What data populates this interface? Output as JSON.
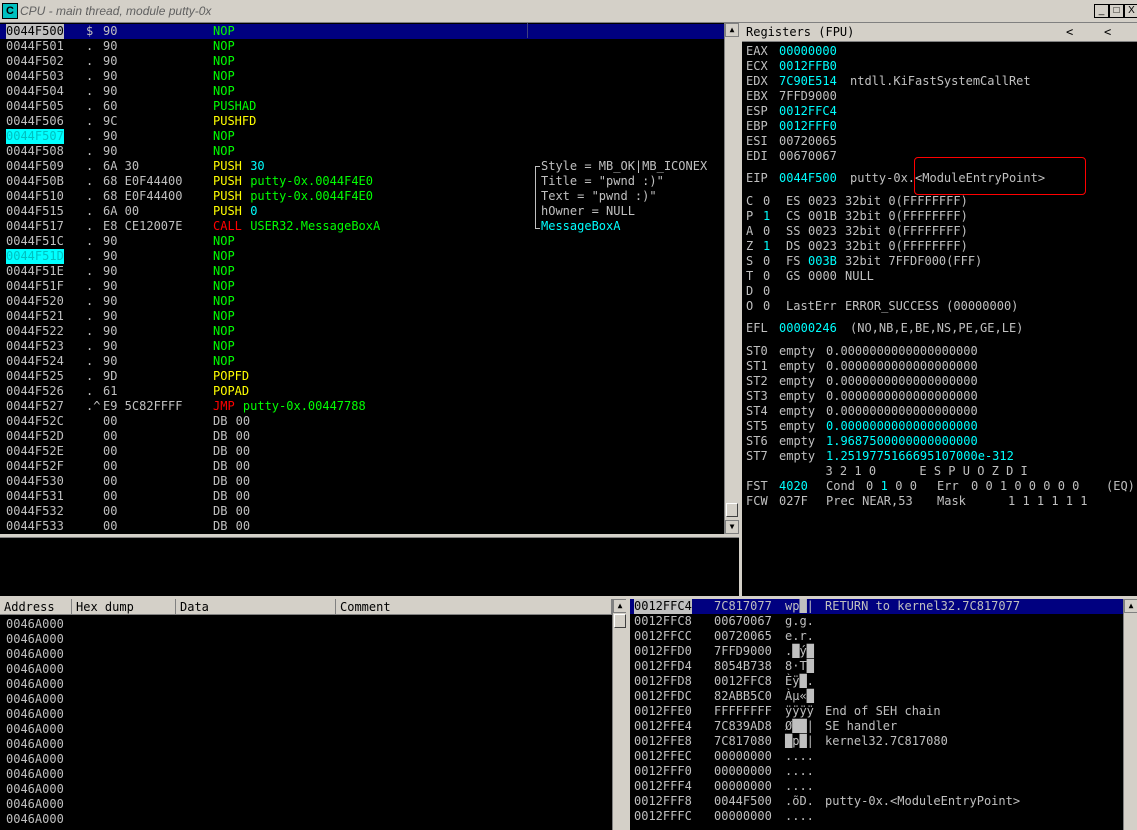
{
  "window": {
    "title": "CPU - main thread, module putty-0x",
    "icon_letter": "C",
    "min_label": "_",
    "max_label": "□",
    "close_label": "X"
  },
  "disasm": {
    "rows": [
      {
        "addr": "0044F500",
        "mark": "$",
        "hex": "90",
        "mn": "NOP",
        "mcolor": "green",
        "sel": true
      },
      {
        "addr": "0044F501",
        "mark": ".",
        "hex": "90",
        "mn": "NOP",
        "mcolor": "green"
      },
      {
        "addr": "0044F502",
        "mark": ".",
        "hex": "90",
        "mn": "NOP",
        "mcolor": "green"
      },
      {
        "addr": "0044F503",
        "mark": ".",
        "hex": "90",
        "mn": "NOP",
        "mcolor": "green"
      },
      {
        "addr": "0044F504",
        "mark": ".",
        "hex": "90",
        "mn": "NOP",
        "mcolor": "green"
      },
      {
        "addr": "0044F505",
        "mark": ".",
        "hex": "60",
        "mn": "PUSHAD",
        "mcolor": "green"
      },
      {
        "addr": "0044F506",
        "mark": ".",
        "hex": "9C",
        "mn": "PUSHFD",
        "mcolor": "yellow"
      },
      {
        "addr": "0044F507",
        "mark": ".",
        "hex": "90",
        "mn": "NOP",
        "mcolor": "green",
        "hl": true
      },
      {
        "addr": "0044F508",
        "mark": ".",
        "hex": "90",
        "mn": "NOP",
        "mcolor": "green"
      },
      {
        "addr": "0044F509",
        "mark": ".",
        "hex": "6A 30",
        "mn": "PUSH",
        "mcolor": "yellow",
        "op": "30",
        "opcolor": "cyan",
        "cmt": "Style = MB_OK|MB_ICONEX"
      },
      {
        "addr": "0044F50B",
        "mark": ".",
        "hex": "68 E0F44400",
        "mn": "PUSH",
        "mcolor": "yellow",
        "op": "putty-0x.0044F4E0",
        "opcolor": "green",
        "cmt": "Title = \"pwnd :)\""
      },
      {
        "addr": "0044F510",
        "mark": ".",
        "hex": "68 E0F44400",
        "mn": "PUSH",
        "mcolor": "yellow",
        "op": "putty-0x.0044F4E0",
        "opcolor": "green",
        "cmt": "Text = \"pwnd :)\""
      },
      {
        "addr": "0044F515",
        "mark": ".",
        "hex": "6A 00",
        "mn": "PUSH",
        "mcolor": "yellow",
        "op": "0",
        "opcolor": "cyan",
        "cmt": "hOwner = NULL"
      },
      {
        "addr": "0044F517",
        "mark": ".",
        "hex": "E8 CE12007E",
        "mn": "CALL",
        "mcolor": "red",
        "op": "USER32.MessageBoxA",
        "opcolor": "green",
        "cmt": "MessageBoxA",
        "cmtcolor": "cyan"
      },
      {
        "addr": "0044F51C",
        "mark": ".",
        "hex": "90",
        "mn": "NOP",
        "mcolor": "green"
      },
      {
        "addr": "0044F51D",
        "mark": ".",
        "hex": "90",
        "mn": "NOP",
        "mcolor": "green",
        "hl": true
      },
      {
        "addr": "0044F51E",
        "mark": ".",
        "hex": "90",
        "mn": "NOP",
        "mcolor": "green"
      },
      {
        "addr": "0044F51F",
        "mark": ".",
        "hex": "90",
        "mn": "NOP",
        "mcolor": "green"
      },
      {
        "addr": "0044F520",
        "mark": ".",
        "hex": "90",
        "mn": "NOP",
        "mcolor": "green"
      },
      {
        "addr": "0044F521",
        "mark": ".",
        "hex": "90",
        "mn": "NOP",
        "mcolor": "green"
      },
      {
        "addr": "0044F522",
        "mark": ".",
        "hex": "90",
        "mn": "NOP",
        "mcolor": "green"
      },
      {
        "addr": "0044F523",
        "mark": ".",
        "hex": "90",
        "mn": "NOP",
        "mcolor": "green"
      },
      {
        "addr": "0044F524",
        "mark": ".",
        "hex": "90",
        "mn": "NOP",
        "mcolor": "green"
      },
      {
        "addr": "0044F525",
        "mark": ".",
        "hex": "9D",
        "mn": "POPFD",
        "mcolor": "yellow"
      },
      {
        "addr": "0044F526",
        "mark": ".",
        "hex": "61",
        "mn": "POPAD",
        "mcolor": "yellow"
      },
      {
        "addr": "0044F527",
        "mark": ".^",
        "hex": "E9 5C82FFFF",
        "mn": "JMP",
        "mcolor": "red",
        "op": "putty-0x.00447788",
        "opcolor": "green"
      },
      {
        "addr": "0044F52C",
        "mark": "",
        "hex": "00",
        "mn": "DB",
        "mcolor": "white",
        "op": "00",
        "opcolor": "white"
      },
      {
        "addr": "0044F52D",
        "mark": "",
        "hex": "00",
        "mn": "DB",
        "mcolor": "white",
        "op": "00",
        "opcolor": "white"
      },
      {
        "addr": "0044F52E",
        "mark": "",
        "hex": "00",
        "mn": "DB",
        "mcolor": "white",
        "op": "00",
        "opcolor": "white"
      },
      {
        "addr": "0044F52F",
        "mark": "",
        "hex": "00",
        "mn": "DB",
        "mcolor": "white",
        "op": "00",
        "opcolor": "white"
      },
      {
        "addr": "0044F530",
        "mark": "",
        "hex": "00",
        "mn": "DB",
        "mcolor": "white",
        "op": "00",
        "opcolor": "white"
      },
      {
        "addr": "0044F531",
        "mark": "",
        "hex": "00",
        "mn": "DB",
        "mcolor": "white",
        "op": "00",
        "opcolor": "white"
      },
      {
        "addr": "0044F532",
        "mark": "",
        "hex": "00",
        "mn": "DB",
        "mcolor": "white",
        "op": "00",
        "opcolor": "white"
      },
      {
        "addr": "0044F533",
        "mark": "",
        "hex": "00",
        "mn": "DB",
        "mcolor": "white",
        "op": "00",
        "opcolor": "white"
      }
    ]
  },
  "registers": {
    "header": "Registers (FPU)",
    "nav_left": "<",
    "nav_right": "<",
    "general": [
      {
        "name": "EAX",
        "val": "00000000",
        "vcolor": "cyan",
        "info": ""
      },
      {
        "name": "ECX",
        "val": "0012FFB0",
        "vcolor": "cyan",
        "info": ""
      },
      {
        "name": "EDX",
        "val": "7C90E514",
        "vcolor": "cyan",
        "info": "ntdll.KiFastSystemCallRet"
      },
      {
        "name": "EBX",
        "val": "7FFD9000",
        "vcolor": "white",
        "info": ""
      },
      {
        "name": "ESP",
        "val": "0012FFC4",
        "vcolor": "cyan",
        "info": ""
      },
      {
        "name": "EBP",
        "val": "0012FFF0",
        "vcolor": "cyan",
        "info": ""
      },
      {
        "name": "ESI",
        "val": "00720065",
        "vcolor": "white",
        "info": ""
      },
      {
        "name": "EDI",
        "val": "00670067",
        "vcolor": "white",
        "info": ""
      }
    ],
    "eip": {
      "name": "EIP",
      "val": "0044F500",
      "info": "putty-0x.<ModuleEntryPoint>"
    },
    "flags": [
      {
        "f": "C",
        "v": "0",
        "vc": "white",
        "seg": "ES",
        "sv": "0023",
        "svc": "white",
        "rest": "32bit 0(FFFFFFFF)"
      },
      {
        "f": "P",
        "v": "1",
        "vc": "cyan",
        "seg": "CS",
        "sv": "001B",
        "svc": "white",
        "rest": "32bit 0(FFFFFFFF)"
      },
      {
        "f": "A",
        "v": "0",
        "vc": "white",
        "seg": "SS",
        "sv": "0023",
        "svc": "white",
        "rest": "32bit 0(FFFFFFFF)"
      },
      {
        "f": "Z",
        "v": "1",
        "vc": "cyan",
        "seg": "DS",
        "sv": "0023",
        "svc": "white",
        "rest": "32bit 0(FFFFFFFF)"
      },
      {
        "f": "S",
        "v": "0",
        "vc": "white",
        "seg": "FS",
        "sv": "003B",
        "svc": "cyan",
        "rest": "32bit 7FFDF000(FFF)"
      },
      {
        "f": "T",
        "v": "0",
        "vc": "white",
        "seg": "GS",
        "sv": "0000",
        "svc": "white",
        "rest": "NULL"
      },
      {
        "f": "D",
        "v": "0",
        "vc": "white",
        "seg": "",
        "sv": "",
        "svc": "white",
        "rest": ""
      },
      {
        "f": "O",
        "v": "0",
        "vc": "white",
        "seg": "LastErr",
        "sv": "",
        "svc": "white",
        "rest": "ERROR_SUCCESS (00000000)"
      }
    ],
    "efl": {
      "name": "EFL",
      "val": "00000246",
      "info": "(NO,NB,E,BE,NS,PE,GE,LE)"
    },
    "fpu": [
      {
        "name": "ST0",
        "tag": "empty",
        "val": "0.0000000000000000000",
        "vcolor": "white"
      },
      {
        "name": "ST1",
        "tag": "empty",
        "val": "0.0000000000000000000",
        "vcolor": "white"
      },
      {
        "name": "ST2",
        "tag": "empty",
        "val": "0.0000000000000000000",
        "vcolor": "white"
      },
      {
        "name": "ST3",
        "tag": "empty",
        "val": "0.0000000000000000000",
        "vcolor": "white"
      },
      {
        "name": "ST4",
        "tag": "empty",
        "val": "0.0000000000000000000",
        "vcolor": "white"
      },
      {
        "name": "ST5",
        "tag": "empty",
        "val": "0.0000000000000000000",
        "vcolor": "cyan"
      },
      {
        "name": "ST6",
        "tag": "empty",
        "val": "1.9687500000000000000",
        "vcolor": "cyan"
      },
      {
        "name": "ST7",
        "tag": "empty",
        "val": "1.2519775166695107000e-312",
        "vcolor": "cyan"
      }
    ],
    "bit_header": "           3 2 1 0      E S P U O Z D I",
    "fst": {
      "name": "FST",
      "val": "4020",
      "cond_label": "Cond",
      "cond": [
        "0",
        "1",
        "0",
        "0",
        "0"
      ],
      "err_label": "Err",
      "err": "0 0 1 0 0 0 0 0",
      "eq": "(EQ)"
    },
    "fcw": {
      "name": "FCW",
      "val": "027F",
      "prec": "Prec NEAR,53",
      "mask_label": "Mask",
      "mask": "1 1 1 1 1 1"
    }
  },
  "dump": {
    "headers": [
      "Address",
      "Hex dump",
      "Data",
      "Comment"
    ],
    "rows": [
      "0046A000",
      "0046A000",
      "0046A000",
      "0046A000",
      "0046A000",
      "0046A000",
      "0046A000",
      "0046A000",
      "0046A000",
      "0046A000",
      "0046A000",
      "0046A000",
      "0046A000",
      "0046A000"
    ]
  },
  "stack": {
    "rows": [
      {
        "addr": "0012FFC4",
        "val": "7C817077",
        "ascii": "wp█|",
        "cmt": "RETURN to kernel32.7C817077",
        "sel": true
      },
      {
        "addr": "0012FFC8",
        "val": "00670067",
        "ascii": "g.g.",
        "cmt": ""
      },
      {
        "addr": "0012FFCC",
        "val": "00720065",
        "ascii": "e.r.",
        "cmt": ""
      },
      {
        "addr": "0012FFD0",
        "val": "7FFD9000",
        "ascii": ".█ý█",
        "cmt": ""
      },
      {
        "addr": "0012FFD4",
        "val": "8054B738",
        "ascii": "8·T█",
        "cmt": ""
      },
      {
        "addr": "0012FFD8",
        "val": "0012FFC8",
        "ascii": "Èÿ█.",
        "cmt": ""
      },
      {
        "addr": "0012FFDC",
        "val": "82ABB5C0",
        "ascii": "Àµ«█",
        "cmt": ""
      },
      {
        "addr": "0012FFE0",
        "val": "FFFFFFFF",
        "ascii": "ÿÿÿÿ",
        "cmt": "End of SEH chain"
      },
      {
        "addr": "0012FFE4",
        "val": "7C839AD8",
        "ascii": "Ø██|",
        "cmt": "SE handler"
      },
      {
        "addr": "0012FFE8",
        "val": "7C817080",
        "ascii": "█p█|",
        "cmt": "kernel32.7C817080"
      },
      {
        "addr": "0012FFEC",
        "val": "00000000",
        "ascii": "....",
        "cmt": ""
      },
      {
        "addr": "0012FFF0",
        "val": "00000000",
        "ascii": "....",
        "cmt": ""
      },
      {
        "addr": "0012FFF4",
        "val": "00000000",
        "ascii": "....",
        "cmt": ""
      },
      {
        "addr": "0012FFF8",
        "val": "0044F500",
        "ascii": ".õD.",
        "cmt": "putty-0x.<ModuleEntryPoint>"
      },
      {
        "addr": "0012FFFC",
        "val": "00000000",
        "ascii": "....",
        "cmt": ""
      }
    ]
  }
}
